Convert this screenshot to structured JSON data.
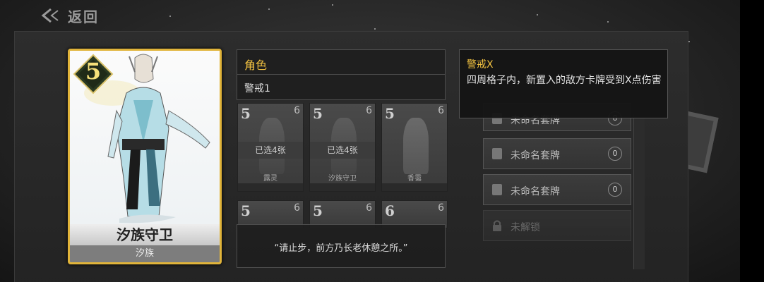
{
  "nav": {
    "back_label": "返回"
  },
  "selected_card": {
    "cost": "5",
    "name": "汐族守卫",
    "clan": "汐族"
  },
  "info": {
    "role_label": "角色",
    "skill": "警戒1",
    "quote": "“请止步，前方乃长老休憩之所。”"
  },
  "tooltip": {
    "title": "警戒X",
    "desc": "四周格子内，新置入的敌方卡牌受到X点伤害"
  },
  "grid_cards": [
    {
      "cost": "5",
      "atk": "6",
      "name": "露灵",
      "selected": "已选4张"
    },
    {
      "cost": "5",
      "atk": "6",
      "name": "汐族守卫",
      "selected": "已选4张"
    },
    {
      "cost": "5",
      "atk": "6",
      "name": "香霭",
      "selected": ""
    },
    {
      "cost": "5",
      "atk": "6",
      "name": "",
      "selected": ""
    },
    {
      "cost": "5",
      "atk": "6",
      "name": "",
      "selected": ""
    },
    {
      "cost": "6",
      "atk": "6",
      "name": "",
      "selected": ""
    }
  ],
  "decks": [
    {
      "label": "未命名套牌",
      "count": "0"
    },
    {
      "label": "未命名套牌",
      "count": "0"
    },
    {
      "label": "未命名套牌",
      "count": "0"
    },
    {
      "label": "未解锁",
      "count": ""
    }
  ],
  "colors": {
    "gold": "#e1b43a",
    "accent_text": "#f0c040",
    "background": "#262626"
  }
}
